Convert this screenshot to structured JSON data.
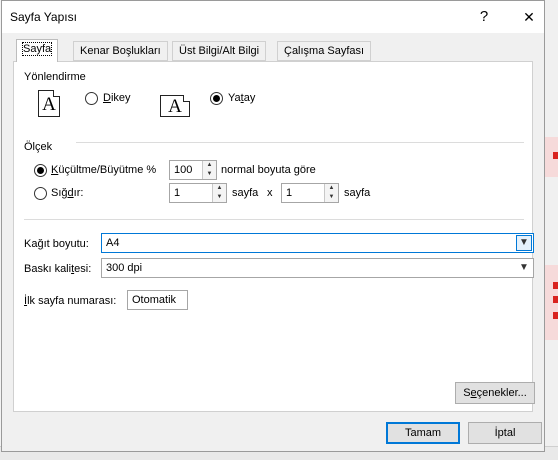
{
  "dialog": {
    "title": "Sayfa Yapısı",
    "help_glyph": "?",
    "close_glyph": "✕"
  },
  "tabs": [
    {
      "label": "Sayfa",
      "active": true
    },
    {
      "label": "Kenar Boşlukları",
      "active": false
    },
    {
      "label": "Üst Bilgi/Alt Bilgi",
      "active": false
    },
    {
      "label": "Çalışma Sayfası",
      "active": false
    }
  ],
  "orientation": {
    "heading": "Yönlendirme",
    "page_glyph": "A",
    "portrait": {
      "label_pre": "",
      "mnemonic": "D",
      "label_post": "ikey",
      "selected": false
    },
    "landscape": {
      "label_pre": "Ya",
      "mnemonic": "t",
      "label_post": "ay",
      "selected": true
    }
  },
  "scaling": {
    "heading": "Ölçek",
    "adjust": {
      "label_pre": "",
      "mnemonic": "K",
      "label_post": "üçültme/Büyütme %",
      "selected": true,
      "value": "100",
      "suffix": "normal boyuta göre"
    },
    "fit": {
      "label_pre": "Sığ",
      "mnemonic": "d",
      "label_post": "ır:",
      "selected": false,
      "wide_value": "1",
      "wide_unit": "sayfa",
      "separator": "x",
      "tall_value": "1",
      "tall_unit": "sayfa"
    }
  },
  "paper": {
    "size_label_pre": "Ka",
    "size_label_mn": "ğ",
    "size_label_post": "ıt boyutu:",
    "size_value": "A4",
    "quality_label_pre": "Baskı kali",
    "quality_label_mn": "t",
    "quality_label_post": "esi:",
    "quality_value": "300 dpi",
    "first_page_label_pre": "",
    "first_page_label_mn": "İ",
    "first_page_label_post": "lk sayfa numarası:",
    "first_page_value": "Otomatik"
  },
  "buttons": {
    "options_pre": "S",
    "options_mn": "e",
    "options_post": "çenekler...",
    "ok": "Tamam",
    "cancel": "İptal"
  },
  "colors": {
    "accent": "#0078d7",
    "dialog_bg": "#f0f0f0",
    "panel_bg": "#ffffff"
  }
}
